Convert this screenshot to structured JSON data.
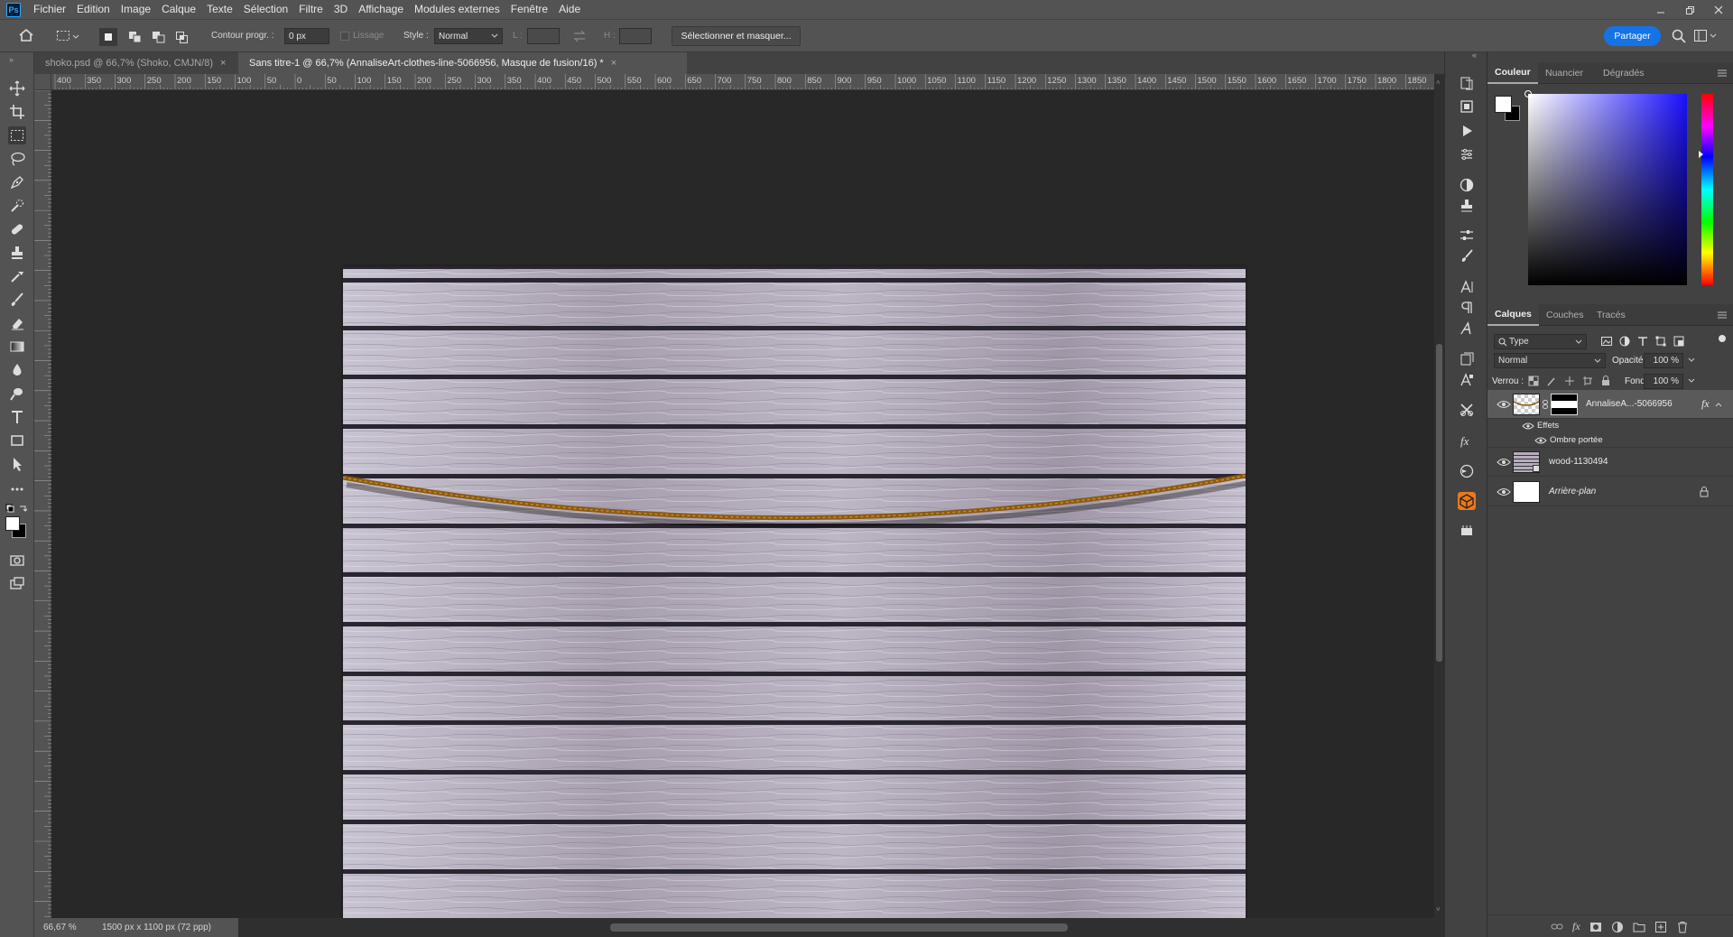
{
  "app": {
    "logo": "Ps",
    "menu": [
      "Fichier",
      "Edition",
      "Image",
      "Calque",
      "Texte",
      "Sélection",
      "Filtre",
      "3D",
      "Affichage",
      "Modules externes",
      "Fenêtre",
      "Aide"
    ]
  },
  "options_bar": {
    "contour_label": "Contour progr. :",
    "contour_value": "0 px",
    "lissage_label": "Lissage",
    "style_label": "Style :",
    "style_value": "Normal",
    "l_label": "L :",
    "h_label": "H :",
    "select_mask_label": "Sélectionner et masquer...",
    "share_label": "Partager"
  },
  "tabs": [
    {
      "label": "shoko.psd @ 66,7% (Shoko, CMJN/8)",
      "close": "×",
      "active": false
    },
    {
      "label": "Sans titre-1 @ 66,7% (AnnaliseArt-clothes-line-5066956, Masque de fusion/16) *",
      "close": "×",
      "active": true
    }
  ],
  "ruler": {
    "h_labels": [
      "400",
      "350",
      "300",
      "250",
      "200",
      "150",
      "100",
      "50",
      "0",
      "50",
      "100",
      "150",
      "200",
      "250",
      "300",
      "350",
      "400",
      "450",
      "500",
      "550",
      "600",
      "650",
      "700",
      "750",
      "800",
      "850",
      "900",
      "950",
      "1000",
      "1050",
      "1100",
      "1150",
      "1200",
      "1250",
      "1300",
      "1350",
      "1400",
      "1450",
      "1500",
      "1550",
      "1600",
      "1650",
      "1700",
      "1750",
      "1800",
      "1850"
    ]
  },
  "status": {
    "zoom": "66,67 %",
    "doc_size": "1500 px x 1100 px (72 ppp)",
    "arrow": "›"
  },
  "color_panel": {
    "tabs": [
      "Couleur",
      "Nuancier",
      "Dégradés"
    ],
    "active": "Couleur"
  },
  "layers_panel": {
    "tabs": [
      "Calques",
      "Couches",
      "Tracés"
    ],
    "active": "Calques",
    "filter_label": "Type",
    "blend_mode": "Normal",
    "opacity_label": "Opacité :",
    "opacity_value": "100 %",
    "lock_label": "Verrou :",
    "fill_label": "Fond :",
    "fill_value": "100 %",
    "layers": [
      {
        "name": "AnnaliseA...-5066956",
        "fx": "fx",
        "selected": true
      },
      {
        "name": "wood-1130494",
        "selected": false
      },
      {
        "name": "Arrière-plan",
        "selected": false,
        "locked": true
      }
    ],
    "effects_label": "Effets",
    "drop_shadow_label": "Ombre portée",
    "bottom_icons": [
      "link-icon",
      "fx-icon",
      "mask-icon",
      "adjustment-icon",
      "group-icon",
      "new-layer-icon",
      "trash-icon"
    ],
    "bottom_fx": "fx"
  },
  "colors": {
    "accent": "#1473e6",
    "rope": "#8a5a12",
    "wood": "#b9b3c1"
  }
}
